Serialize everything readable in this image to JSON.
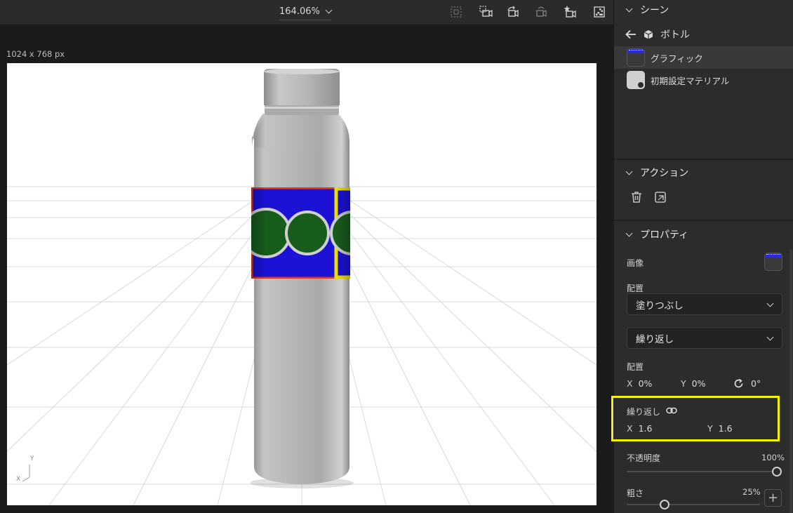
{
  "toolbar": {
    "zoom": "164.06%",
    "tools": [
      "frame-select-icon",
      "camera-fit-icon",
      "camera-rotate-icon",
      "camera-reset-icon",
      "camera-favorite-icon",
      "render-icon"
    ]
  },
  "canvas": {
    "size_label": "1024 x 768 px",
    "axis_y": "Y",
    "axis_x": "X"
  },
  "panel": {
    "scene": {
      "title": "シーン",
      "breadcrumb": "ボトル",
      "layers": [
        {
          "label": "グラフィック",
          "selected": true
        },
        {
          "label": "初期設定マテリアル",
          "selected": false
        }
      ]
    },
    "actions": {
      "title": "アクション",
      "icons": [
        "trash-icon",
        "export-icon"
      ]
    },
    "properties": {
      "title": "プロパティ",
      "image_label": "画像",
      "placement_label": "配置",
      "fill_mode": "塗りつぶし",
      "repeat_mode": "繰り返し",
      "offset_label": "配置",
      "offset": {
        "x_axis": "X",
        "x": "0%",
        "y_axis": "Y",
        "y": "0%",
        "rotation": "0°"
      },
      "repeat_label": "繰り返し",
      "repeat": {
        "x_axis": "X",
        "x": "1.6",
        "y_axis": "Y",
        "y": "1.6"
      },
      "opacity_label": "不透明度",
      "opacity_value": "100%",
      "opacity": 1.0,
      "roughness_label": "粗さ",
      "roughness_value": "25%",
      "roughness": 0.25,
      "plus": "+"
    }
  },
  "colors": {
    "highlight": "#f4f400",
    "label_blue": "#1b12d6",
    "label_red": "#e03a1a",
    "label_yellow": "#f0e000",
    "circle_green": "#185c1c"
  }
}
